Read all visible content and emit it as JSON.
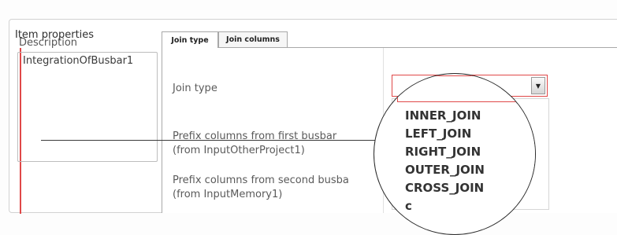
{
  "panel": {
    "title": "Item properties"
  },
  "description": {
    "label": "Description",
    "value": "IntegrationOfBusbar1"
  },
  "tabs": [
    {
      "label": "Join type",
      "active": true
    },
    {
      "label": "Join columns",
      "active": false
    }
  ],
  "form": {
    "join_type_label": "Join type",
    "prefix_first_label": "Prefix columns from first busbar",
    "prefix_first_source": "(from InputOtherProject1)",
    "prefix_second_label": "Prefix columns from second busba",
    "prefix_second_source": "(from InputMemory1)"
  },
  "join_type_select": {
    "value": "",
    "options": [
      "INNER_JOIN",
      "LEFT_JOIN",
      "RIGHT_JOIN",
      "OUTER_JOIN",
      "CROSS_JOIN"
    ],
    "partial_next": "c"
  },
  "colors": {
    "error_red": "#e04848",
    "border": "#a8a8a8"
  }
}
